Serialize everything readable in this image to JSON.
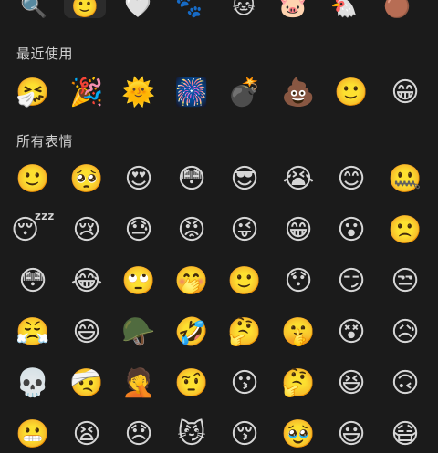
{
  "tabs": [
    {
      "name": "search-icon",
      "glyph": "🔍",
      "active": false
    },
    {
      "name": "emoji-tab-icon",
      "glyph": "🙂",
      "active": true
    },
    {
      "name": "favorites-heart-icon",
      "glyph": "🤍",
      "active": false
    },
    {
      "name": "sticker-pack-1-icon",
      "glyph": "🐾",
      "active": false
    },
    {
      "name": "sticker-pack-2-icon",
      "glyph": "🐱",
      "active": false
    },
    {
      "name": "sticker-pack-3-icon",
      "glyph": "🐷",
      "active": false
    },
    {
      "name": "sticker-pack-4-icon",
      "glyph": "🐔",
      "active": false
    },
    {
      "name": "sticker-pack-5-icon",
      "glyph": "🟤",
      "active": false
    }
  ],
  "sections": {
    "recent": {
      "title": "最近使用",
      "items": [
        {
          "name": "sneeze-face-icon",
          "glyph": "🤧"
        },
        {
          "name": "party-popper-icon",
          "glyph": "🎉"
        },
        {
          "name": "sun-icon",
          "glyph": "🌞"
        },
        {
          "name": "fireworks-icon",
          "glyph": "🎆"
        },
        {
          "name": "bomb-icon",
          "glyph": "💣"
        },
        {
          "name": "poop-icon",
          "glyph": "💩"
        },
        {
          "name": "smile-face-icon",
          "glyph": "🙂"
        },
        {
          "name": "grin-face-icon",
          "glyph": "😁"
        }
      ]
    },
    "all": {
      "title": "所有表情",
      "items": [
        {
          "name": "smile-face-icon",
          "glyph": "🙂"
        },
        {
          "name": "worried-face-icon",
          "glyph": "🥺"
        },
        {
          "name": "heart-eyes-face-icon",
          "glyph": "😍"
        },
        {
          "name": "stare-face-icon",
          "glyph": "😳"
        },
        {
          "name": "sunglasses-face-icon",
          "glyph": "😎"
        },
        {
          "name": "crying-face-icon",
          "glyph": "😭"
        },
        {
          "name": "shy-face-icon",
          "glyph": "😊"
        },
        {
          "name": "zipped-mouth-face-icon",
          "glyph": "🤐"
        },
        {
          "name": "sleeping-face-icon",
          "glyph": "😴"
        },
        {
          "name": "sad-crying-face-icon",
          "glyph": "😢"
        },
        {
          "name": "embarrassed-face-icon",
          "glyph": "😓"
        },
        {
          "name": "angry-face-icon",
          "glyph": "😡"
        },
        {
          "name": "tongue-wink-face-icon",
          "glyph": "😜"
        },
        {
          "name": "grin-face-icon",
          "glyph": "😁"
        },
        {
          "name": "surprised-face-icon",
          "glyph": "😮"
        },
        {
          "name": "frown-face-icon",
          "glyph": "🙁"
        },
        {
          "name": "blush-face-icon",
          "glyph": "😳"
        },
        {
          "name": "laughing-tears-face-icon",
          "glyph": "😂"
        },
        {
          "name": "rolling-eyes-face-icon",
          "glyph": "🙄"
        },
        {
          "name": "giggle-face-icon",
          "glyph": "🤭"
        },
        {
          "name": "slight-smile-face-icon",
          "glyph": "🙂"
        },
        {
          "name": "wide-eyes-face-icon",
          "glyph": "😯"
        },
        {
          "name": "smirk-face-icon",
          "glyph": "😏"
        },
        {
          "name": "unamused-face-icon",
          "glyph": "😒"
        },
        {
          "name": "furious-face-icon",
          "glyph": "😤"
        },
        {
          "name": "happy-face-icon",
          "glyph": "😄"
        },
        {
          "name": "soldier-face-icon",
          "glyph": "🪖"
        },
        {
          "name": "rofl-face-icon",
          "glyph": "🤣"
        },
        {
          "name": "confused-face-icon",
          "glyph": "🤔"
        },
        {
          "name": "shush-face-icon",
          "glyph": "🤫"
        },
        {
          "name": "dizzy-face-icon",
          "glyph": "😵"
        },
        {
          "name": "dark-sweat-face-icon",
          "glyph": "😥"
        },
        {
          "name": "skull-icon",
          "glyph": "💀"
        },
        {
          "name": "head-bandage-face-icon",
          "glyph": "🤕"
        },
        {
          "name": "facepalm-face-icon",
          "glyph": "🤦"
        },
        {
          "name": "side-eye-face-icon",
          "glyph": "🤨"
        },
        {
          "name": "pouting-face-icon",
          "glyph": "😗"
        },
        {
          "name": "thinking-face-icon",
          "glyph": "🤔"
        },
        {
          "name": "laughing-face-icon",
          "glyph": "😆"
        },
        {
          "name": "slanted-smile-face-icon",
          "glyph": "🙃"
        },
        {
          "name": "grimace-face-icon",
          "glyph": "😬"
        },
        {
          "name": "tired-face-icon",
          "glyph": "😫"
        },
        {
          "name": "sad-face-icon",
          "glyph": "😞"
        },
        {
          "name": "sly-face-icon",
          "glyph": "😼"
        },
        {
          "name": "kiss-face-icon",
          "glyph": "😚"
        },
        {
          "name": "cute-face-icon",
          "glyph": "🥹"
        },
        {
          "name": "beaming-face-icon",
          "glyph": "😃"
        },
        {
          "name": "mask-face-icon",
          "glyph": "😷"
        }
      ]
    }
  }
}
